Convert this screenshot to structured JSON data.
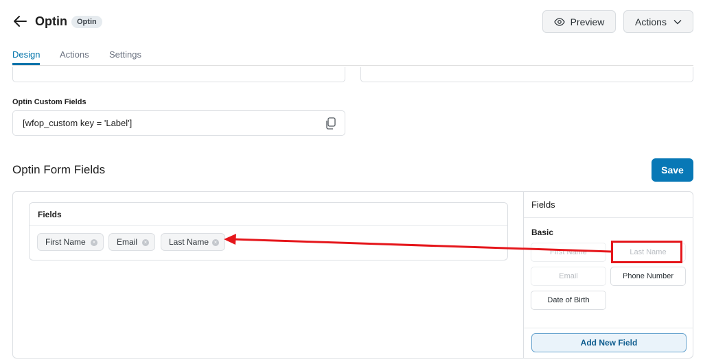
{
  "header": {
    "title": "Optin",
    "badge": "Optin",
    "preview_label": "Preview",
    "actions_label": "Actions"
  },
  "tabs": [
    {
      "label": "Design",
      "active": true
    },
    {
      "label": "Actions",
      "active": false
    },
    {
      "label": "Settings",
      "active": false
    }
  ],
  "custom_fields": {
    "label": "Optin Custom Fields",
    "value": "[wfop_custom key = 'Label']"
  },
  "form_fields": {
    "section_title": "Optin Form Fields",
    "save_label": "Save",
    "card_title": "Fields",
    "chips": [
      "First Name",
      "Email",
      "Last Name"
    ]
  },
  "side_panel": {
    "title": "Fields",
    "group_label": "Basic",
    "buttons": [
      {
        "label": "First Name",
        "disabled": true
      },
      {
        "label": "Last Name",
        "disabled": true
      },
      {
        "label": "Email",
        "disabled": true
      },
      {
        "label": "Phone Number",
        "disabled": false
      },
      {
        "label": "Date of Birth",
        "disabled": false
      }
    ],
    "add_label": "Add New Field"
  },
  "colors": {
    "accent": "#0073aa",
    "save_button": "#0878b6",
    "annotation": "#e5161b"
  }
}
